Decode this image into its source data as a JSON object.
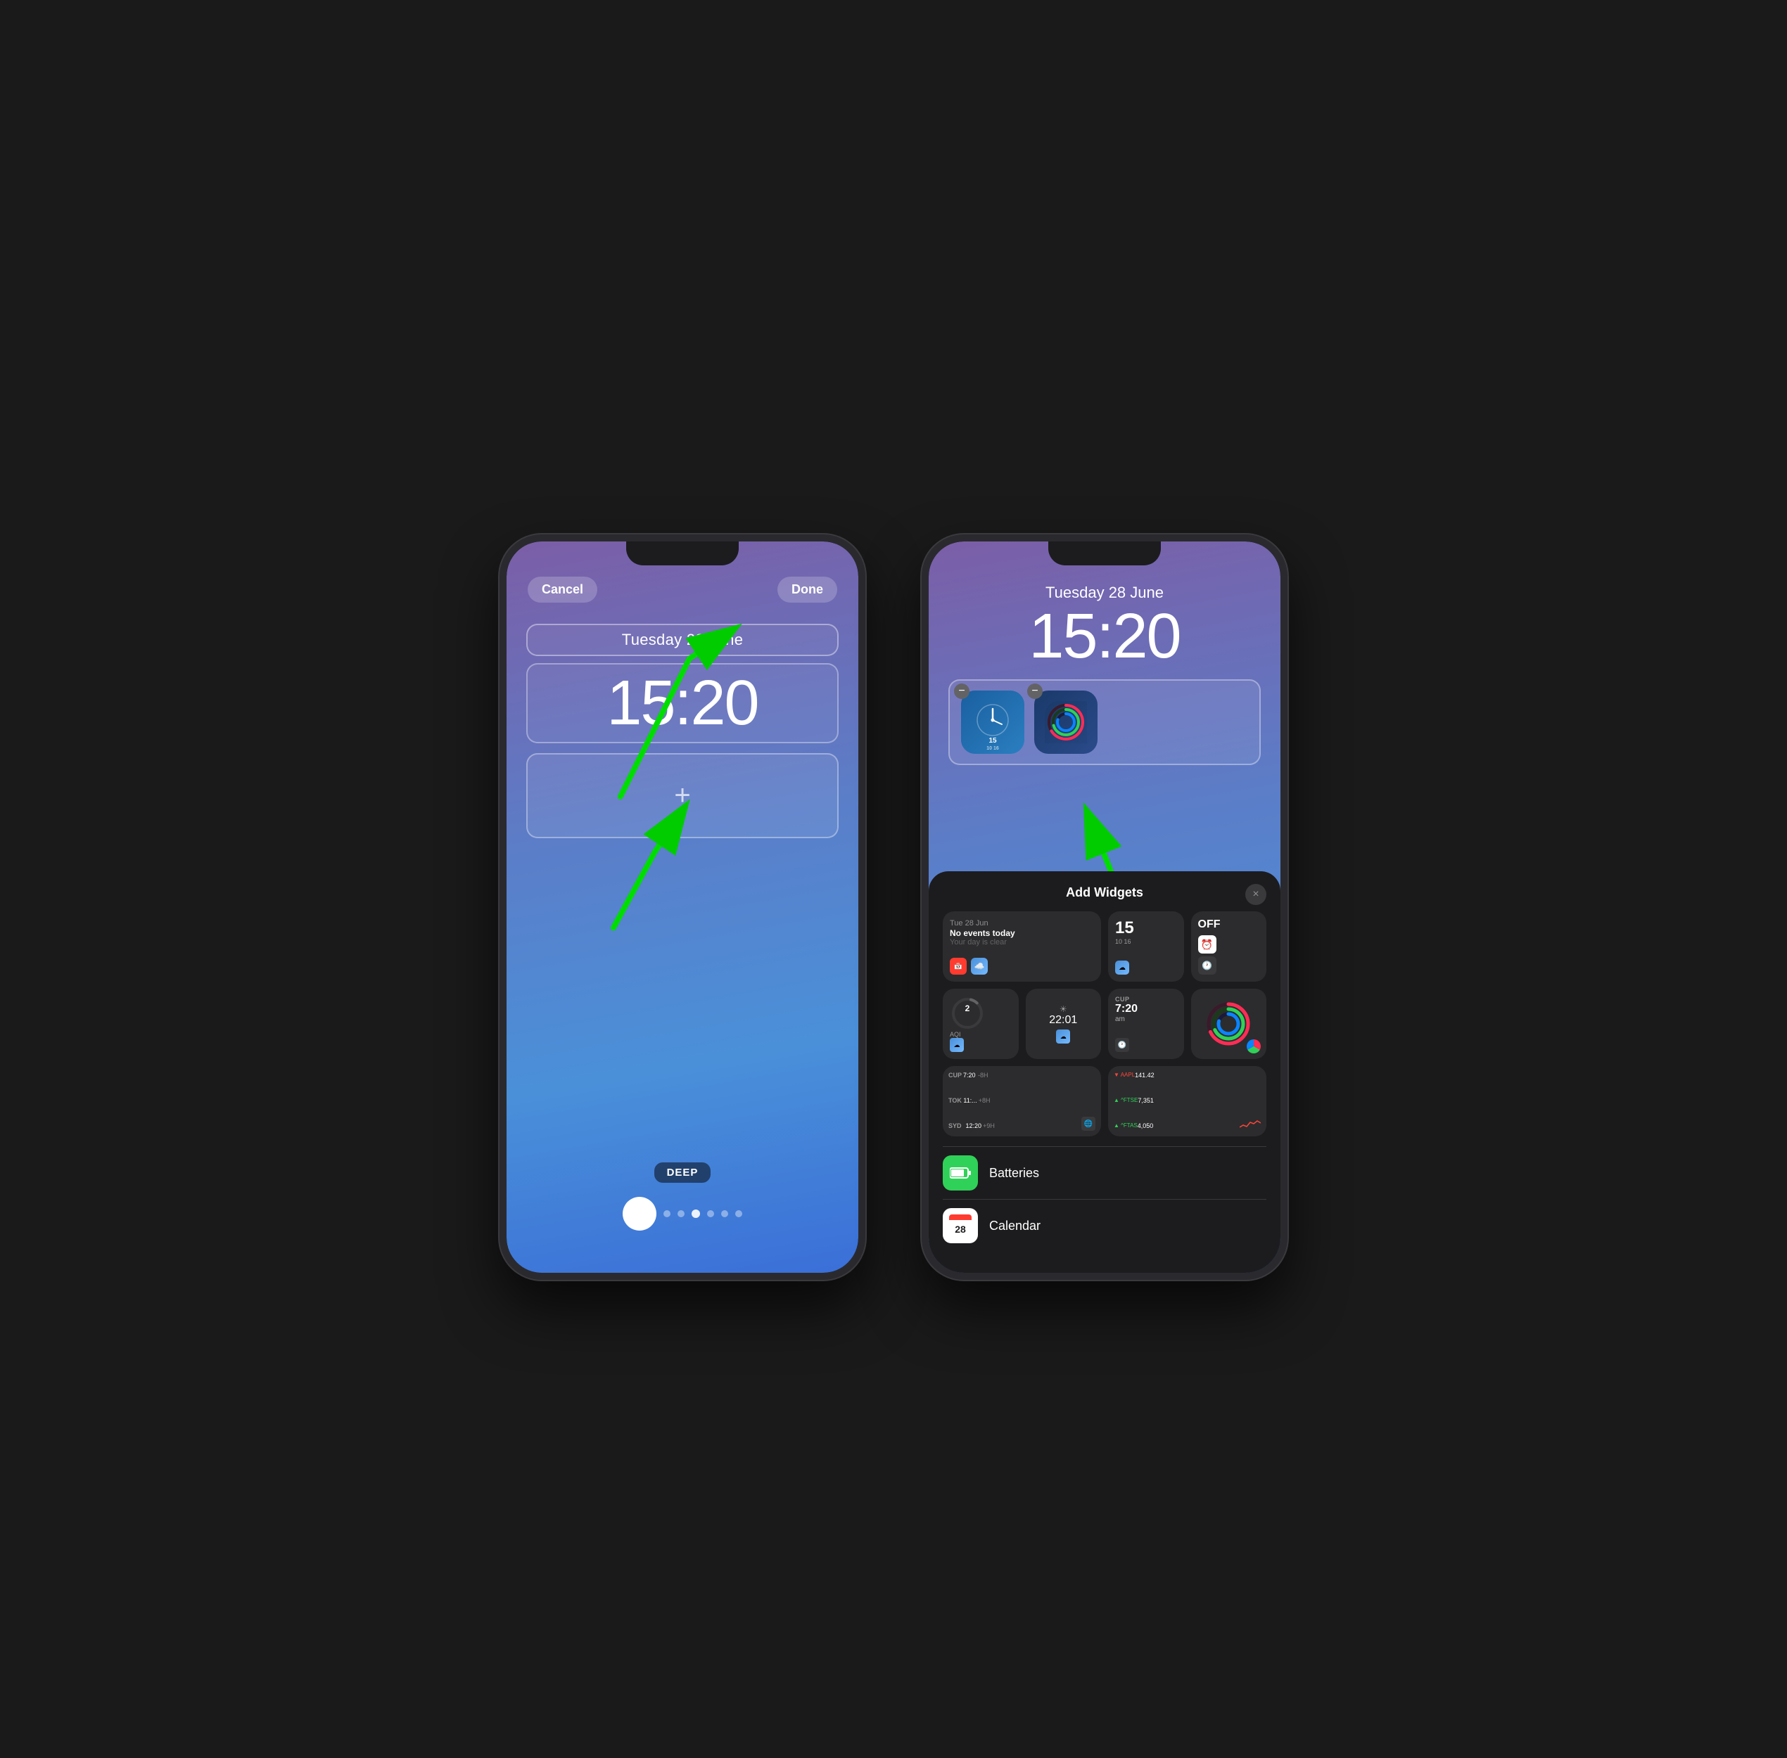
{
  "phone1": {
    "header": {
      "cancel": "Cancel",
      "done": "Done"
    },
    "date": "Tuesday 28 June",
    "time": "15:20",
    "add_widget_plus": "+",
    "wallpaper_label": "DEEP"
  },
  "phone2": {
    "date": "Tuesday 28 June",
    "time": "15:20",
    "widget1": {
      "number": "15",
      "sub": "10  16"
    },
    "panel": {
      "title": "Add Widgets",
      "close": "×",
      "widgets": {
        "calendar": {
          "date": "Tue 28 Jun",
          "no_events": "No events today",
          "clear": "Your day is clear"
        },
        "clock_sm": {
          "number": "15",
          "sub": "10  16"
        },
        "off": "OFF",
        "aqi": {
          "value": "2",
          "label": "AQI"
        },
        "time2201": "22:01",
        "cup_time": {
          "label": "CUP",
          "time": "7:20",
          "ampm": "am"
        },
        "worldclock": {
          "rows": [
            {
              "city": "CUP",
              "time": "7:20",
              "offset": "-8H"
            },
            {
              "city": "TOK",
              "time": "11:...",
              "offset": "+8H"
            },
            {
              "city": "SYD",
              "time": "12:20",
              "offset": "+9H"
            }
          ]
        },
        "stocks": {
          "rows": [
            {
              "dir": "down",
              "name": "▼ AAPL",
              "value": "141.42"
            },
            {
              "dir": "up",
              "name": "▲ ^FTSE",
              "value": "7,351"
            },
            {
              "dir": "up",
              "name": "▲ ^FTAS",
              "value": "4,050"
            }
          ]
        }
      },
      "apps": [
        {
          "name": "Batteries",
          "icon": "battery"
        },
        {
          "name": "Calendar",
          "icon": "calendar"
        }
      ]
    }
  }
}
